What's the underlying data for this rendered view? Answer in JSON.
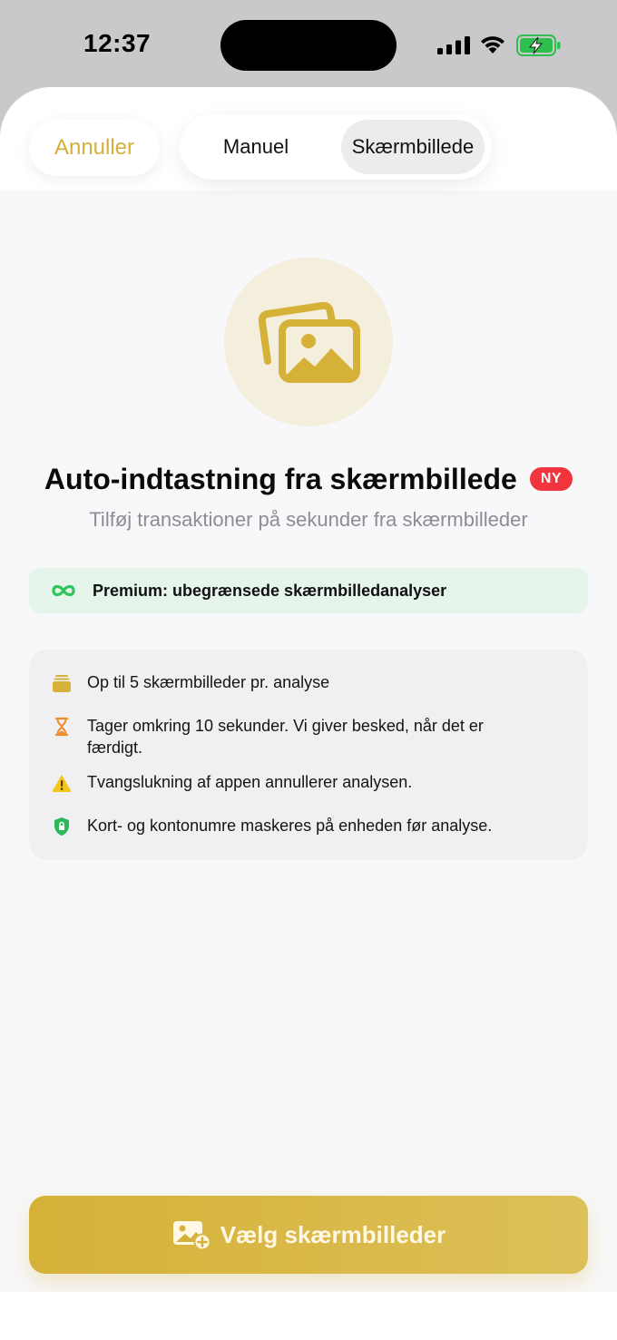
{
  "status_bar": {
    "time": "12:37"
  },
  "header": {
    "cancel_label": "Annuller",
    "tabs": [
      {
        "label": "Manuel",
        "selected": false
      },
      {
        "label": "Skærmbillede",
        "selected": true
      }
    ]
  },
  "hero": {
    "icon": "photos-icon",
    "title": "Auto-indtastning fra skærmbillede",
    "badge": "NY",
    "subtitle": "Tilføj transaktioner på sekunder fra skærmbilleder"
  },
  "premium_banner": {
    "icon": "infinity-icon",
    "text": "Premium: ubegrænsede skærmbilledanalyser"
  },
  "info_items": [
    {
      "icon": "stack-icon",
      "text": "Op til 5 skærmbilleder pr. analyse"
    },
    {
      "icon": "hourglass-icon",
      "text": "Tager omkring 10 sekunder. Vi giver besked, når det er færdigt."
    },
    {
      "icon": "warning-icon",
      "text": "Tvangslukning af appen annullerer analysen."
    },
    {
      "icon": "shield-lock-icon",
      "text": "Kort- og kontonumre maskeres på enheden før analyse."
    }
  ],
  "cta": {
    "icon": "add-photo-icon",
    "label": "Vælg skærmbilleder"
  },
  "colors": {
    "accent": "#d6b138",
    "badge_red": "#f2353d",
    "premium_bg": "#e6f5ec",
    "infinity_green": "#2fc55a",
    "hourglass_orange": "#f08a2a",
    "warning_yellow": "#f5c518",
    "shield_green": "#2fb85a"
  }
}
